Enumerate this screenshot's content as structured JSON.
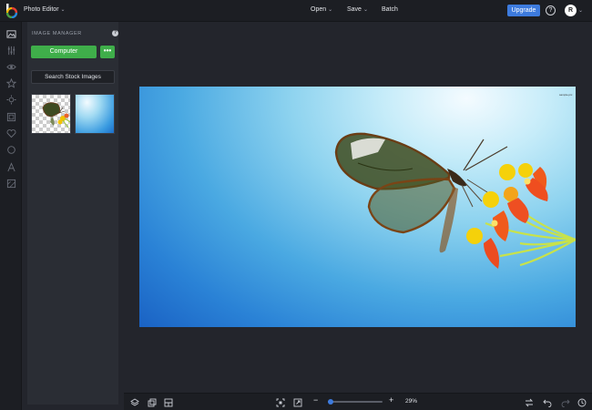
{
  "app": {
    "title": "Photo Editor"
  },
  "topbar": {
    "menus": [
      {
        "label": "Open"
      },
      {
        "label": "Save"
      },
      {
        "label": "Batch"
      }
    ],
    "upgrade_label": "Upgrade",
    "help_icon": "help-circle-icon",
    "avatar_initial": "R"
  },
  "rail": {
    "icons": [
      "image-manager-icon",
      "adjust-sliders-icon",
      "eye-icon",
      "star-icon",
      "touch-up-icon",
      "frames-icon",
      "heart-icon",
      "circle-shape-icon",
      "text-icon",
      "texture-icon"
    ]
  },
  "image_manager": {
    "title": "IMAGE MANAGER",
    "help": "?",
    "computer_label": "Computer",
    "more_label": "•••",
    "stock_label": "Search Stock Images",
    "thumbnails": [
      "butterfly-cutout-thumbnail",
      "blue-background-thumbnail"
    ]
  },
  "canvas": {
    "photo": "butterfly-on-flower-photo",
    "watermark": "sample.pic"
  },
  "bottombar": {
    "left_icons": [
      "layers-icon",
      "duplicate-icon",
      "grid-icon"
    ],
    "center_icons": [
      "fit-screen-icon",
      "expand-icon"
    ],
    "zoom_minus": "−",
    "zoom_plus": "+",
    "zoom_level": 29,
    "zoom_label": "29%",
    "right_icons": [
      "swap-icon",
      "undo-icon",
      "redo-icon",
      "history-icon"
    ]
  },
  "colors": {
    "accent_blue": "#3d7bde",
    "accent_green": "#3fae4a",
    "background": "#23252c",
    "bar": "#1c1e23"
  }
}
